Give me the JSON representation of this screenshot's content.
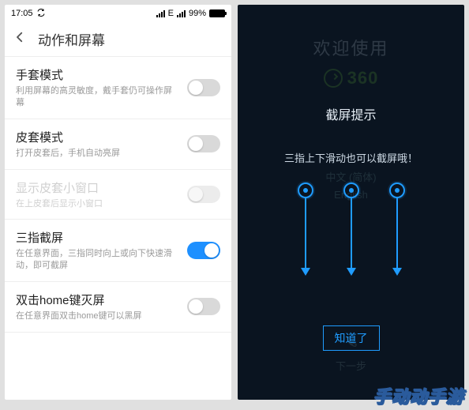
{
  "status": {
    "time": "17:05",
    "net_label": "E",
    "signal_label": "4-bars",
    "battery_percent": "99%"
  },
  "header": {
    "title": "动作和屏幕"
  },
  "settings": [
    {
      "title": "手套模式",
      "desc": "利用屏幕的高灵敏度，戴手套仍可操作屏幕",
      "on": false,
      "disabled": false
    },
    {
      "title": "皮套模式",
      "desc": "打开皮套后，手机自动亮屏",
      "on": false,
      "disabled": false
    },
    {
      "title": "显示皮套小窗口",
      "desc": "在上皮套后显示小窗口",
      "on": false,
      "disabled": true
    },
    {
      "title": "三指截屏",
      "desc": "在任意界面，三指同时向上或向下快速滑动，即可截屏",
      "on": true,
      "disabled": false
    },
    {
      "title": "双击home键灭屏",
      "desc": "在任意界面双击home键可以黑屏",
      "on": false,
      "disabled": false
    }
  ],
  "onboarding": {
    "bg_welcome": "欢迎使用",
    "bg_brand": "360",
    "bg_lang_zh": "中文 (简体)",
    "bg_lang_en": "English",
    "bg_next": "下一步",
    "tip_title": "截屏提示",
    "tip_text": "三指上下滑动也可以截屏哦！",
    "ok": "知道了"
  },
  "watermark": "手动动手游"
}
